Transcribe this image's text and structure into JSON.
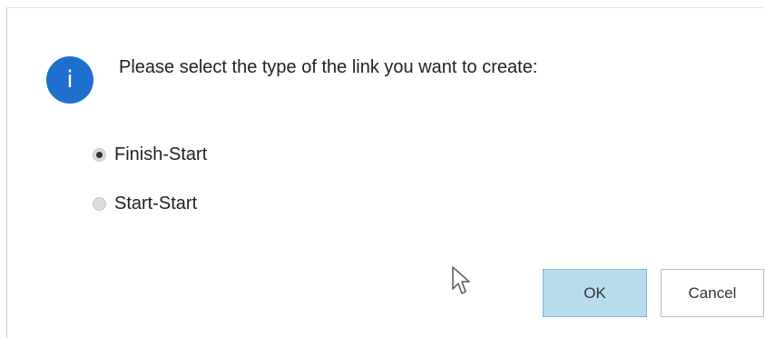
{
  "dialog": {
    "icon": "info-icon",
    "icon_glyph": "i",
    "icon_color": "#1f6fce",
    "message": "Please select the type of the link you want to create:",
    "options": [
      {
        "label": "Finish-Start",
        "selected": true
      },
      {
        "label": "Start-Start",
        "selected": false
      }
    ],
    "buttons": {
      "ok": "OK",
      "cancel": "Cancel"
    },
    "ok_button_color": "#b7dcf0"
  },
  "cursor": "mouse-pointer-icon"
}
